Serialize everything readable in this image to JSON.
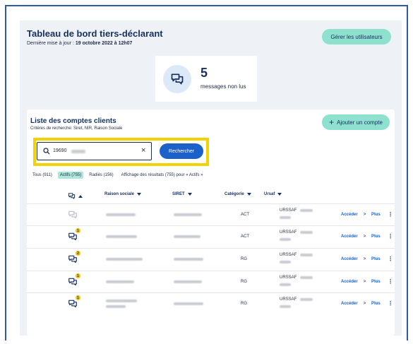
{
  "header": {
    "title": "Tableau de bord tiers-déclarant",
    "last_update_label": "Dernière mise à jour :",
    "last_update_value": "19 octobre 2022 à 12h07",
    "manage_users_label": "Gérer les utilisateurs"
  },
  "messages": {
    "count": "5",
    "label": "messages non lus"
  },
  "accounts": {
    "title": "Liste des comptes clients",
    "criteria": "Critères de recherche: Siret, NIR, Raison Sociale",
    "add_label": "Ajouter un compte",
    "search_value": "19690",
    "search_button": "Rechercher",
    "filters": [
      {
        "label": "Tous (911)",
        "active": false
      },
      {
        "label": "Actifs (755)",
        "active": true
      },
      {
        "label": "Radiés (156)",
        "active": false
      }
    ],
    "result_text": "Affichage des résultats (755) pour « Actifs »",
    "columns": [
      "Raison sociale",
      "SIRET",
      "Catégorie",
      "Ursaf"
    ],
    "rows": [
      {
        "badge": "",
        "category": "ACT",
        "urssaf": "URSSAF",
        "access": "Accéder",
        "more": "Plus"
      },
      {
        "badge": "1",
        "category": "ACT",
        "urssaf": "URSSAF",
        "access": "Accéder",
        "more": "Plus"
      },
      {
        "badge": "2",
        "category": "RG",
        "urssaf": "URSSAF",
        "access": "Accéder",
        "more": "Plus"
      },
      {
        "badge": "1",
        "category": "RG",
        "urssaf": "URSSAF",
        "access": "Accéder",
        "more": "Plus"
      },
      {
        "badge": "1",
        "category": "RG",
        "urssaf": "URSSAF",
        "access": "Accéder",
        "more": "Plus"
      }
    ]
  },
  "icons": [
    "message-icon",
    "search-icon",
    "close-icon",
    "chevron-right-icon",
    "more-vertical-icon",
    "plus-icon"
  ],
  "colors": {
    "accent": "#1b61c9",
    "mint": "#8ee0cf",
    "highlight": "#f2d200",
    "badge": "#f2c400"
  }
}
